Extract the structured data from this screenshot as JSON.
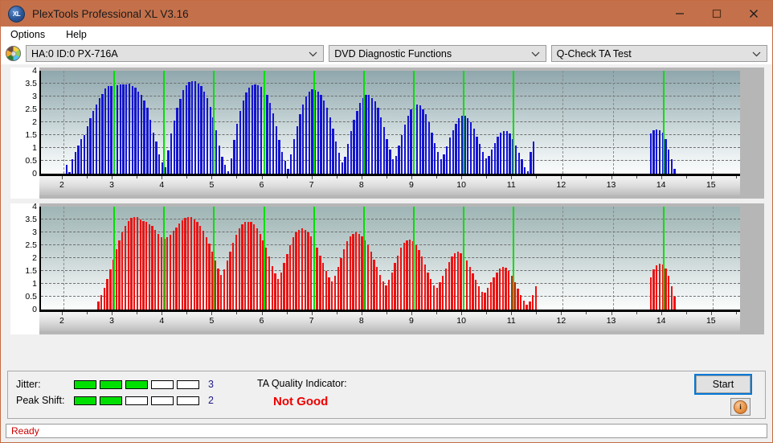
{
  "window": {
    "title": "PlexTools Professional XL V3.16",
    "app_icon": "xl-disc-icon",
    "controls": {
      "minimize": "minimize-icon",
      "maximize": "maximize-icon",
      "close": "close-icon"
    }
  },
  "menubar": {
    "items": [
      {
        "label": "Options"
      },
      {
        "label": "Help"
      }
    ]
  },
  "toolbar": {
    "drive_icon": "disc-icon",
    "drive": "HA:0 ID:0  PX-716A",
    "function": "DVD Diagnostic Functions",
    "test": "Q-Check TA Test"
  },
  "bottom": {
    "jitter_label": "Jitter:",
    "jitter_value": "3",
    "jitter_filled": 3,
    "jitter_total": 5,
    "peak_shift_label": "Peak Shift:",
    "peak_shift_value": "2",
    "peak_shift_filled": 2,
    "peak_shift_total": 5,
    "ta_label": "TA Quality Indicator:",
    "ta_value": "Not Good",
    "ta_color": "#ee0000",
    "start_label": "Start",
    "info_label": "i"
  },
  "statusbar": {
    "text": "Ready"
  },
  "chart_data": [
    {
      "id": "ta-jitter-chart",
      "type": "bar",
      "title": "",
      "xlabel": "",
      "ylabel": "",
      "xlim": [
        1.55,
        15.55
      ],
      "ylim": [
        0,
        4
      ],
      "yticks": [
        0,
        0.5,
        1,
        1.5,
        2,
        2.5,
        3,
        3.5,
        4
      ],
      "xticks": [
        2,
        3,
        4,
        5,
        6,
        7,
        8,
        9,
        10,
        11,
        12,
        13,
        14,
        15
      ],
      "grid": true,
      "bar_color": "#1414d2",
      "marker_color": "#00e000",
      "markers": [
        3,
        4,
        5,
        6,
        7,
        8,
        9,
        10,
        11,
        14
      ],
      "x": [
        2.06,
        2.12,
        2.18,
        2.24,
        2.3,
        2.36,
        2.42,
        2.48,
        2.54,
        2.6,
        2.66,
        2.72,
        2.78,
        2.84,
        2.9,
        2.96,
        3.02,
        3.08,
        3.14,
        3.2,
        3.26,
        3.32,
        3.38,
        3.44,
        3.5,
        3.56,
        3.62,
        3.68,
        3.74,
        3.8,
        3.86,
        3.92,
        3.98,
        4.04,
        4.1,
        4.16,
        4.22,
        4.28,
        4.34,
        4.4,
        4.46,
        4.52,
        4.58,
        4.64,
        4.7,
        4.76,
        4.82,
        4.88,
        4.94,
        5.0,
        5.06,
        5.12,
        5.18,
        5.24,
        5.3,
        5.36,
        5.42,
        5.48,
        5.54,
        5.6,
        5.66,
        5.72,
        5.78,
        5.84,
        5.9,
        5.96,
        6.02,
        6.08,
        6.14,
        6.2,
        6.26,
        6.32,
        6.38,
        6.44,
        6.5,
        6.56,
        6.62,
        6.68,
        6.74,
        6.8,
        6.86,
        6.92,
        6.98,
        7.04,
        7.1,
        7.16,
        7.22,
        7.28,
        7.34,
        7.4,
        7.46,
        7.52,
        7.58,
        7.64,
        7.7,
        7.76,
        7.82,
        7.88,
        7.94,
        8.0,
        8.06,
        8.12,
        8.18,
        8.24,
        8.3,
        8.36,
        8.42,
        8.48,
        8.54,
        8.6,
        8.66,
        8.72,
        8.78,
        8.84,
        8.9,
        8.96,
        9.02,
        9.08,
        9.14,
        9.2,
        9.26,
        9.32,
        9.38,
        9.44,
        9.5,
        9.56,
        9.62,
        9.68,
        9.74,
        9.8,
        9.86,
        9.92,
        9.98,
        10.04,
        10.1,
        10.16,
        10.22,
        10.28,
        10.34,
        10.4,
        10.46,
        10.52,
        10.58,
        10.64,
        10.7,
        10.76,
        10.82,
        10.88,
        10.94,
        11.0,
        11.06,
        11.12,
        11.18,
        11.24,
        11.3,
        11.36,
        11.42,
        13.76,
        13.82,
        13.88,
        13.94,
        14.0,
        14.06,
        14.12,
        14.18,
        14.24,
        14.3
      ],
      "values": [
        0.35,
        0.05,
        0.55,
        0.85,
        1.1,
        1.35,
        1.5,
        1.85,
        2.15,
        2.45,
        2.7,
        2.95,
        3.1,
        3.3,
        3.4,
        3.42,
        3.45,
        3.45,
        3.48,
        3.48,
        3.48,
        3.5,
        3.42,
        3.35,
        3.2,
        3.05,
        2.85,
        2.55,
        2.1,
        1.6,
        1.25,
        0.75,
        0.45,
        0.25,
        0.9,
        1.55,
        2.05,
        2.55,
        2.9,
        3.25,
        3.45,
        3.55,
        3.6,
        3.58,
        3.5,
        3.4,
        3.2,
        2.95,
        2.6,
        2.2,
        1.7,
        1.1,
        0.65,
        0.35,
        0.1,
        0.6,
        1.3,
        1.95,
        2.45,
        2.85,
        3.15,
        3.35,
        3.45,
        3.48,
        3.45,
        3.38,
        3.25,
        3.05,
        2.75,
        2.35,
        1.85,
        1.3,
        0.85,
        0.5,
        0.2,
        0.75,
        1.35,
        1.85,
        2.3,
        2.7,
        3.0,
        3.2,
        3.28,
        3.25,
        3.2,
        3.05,
        2.85,
        2.55,
        2.2,
        1.75,
        1.25,
        0.8,
        0.45,
        0.65,
        1.15,
        1.65,
        2.1,
        2.45,
        2.75,
        2.95,
        3.05,
        3.05,
        2.95,
        2.8,
        2.55,
        2.2,
        1.8,
        1.35,
        0.95,
        0.55,
        0.7,
        1.1,
        1.5,
        1.9,
        2.25,
        2.5,
        2.65,
        2.7,
        2.65,
        2.5,
        2.3,
        2.0,
        1.6,
        1.2,
        0.85,
        0.55,
        0.75,
        1.05,
        1.4,
        1.7,
        1.95,
        2.15,
        2.25,
        2.25,
        2.15,
        2.0,
        1.75,
        1.45,
        1.15,
        0.85,
        0.6,
        0.7,
        0.95,
        1.2,
        1.45,
        1.6,
        1.65,
        1.65,
        1.55,
        1.35,
        1.1,
        0.8,
        0.55,
        0.25,
        0.1,
        0.85,
        1.25,
        1.55,
        1.7,
        1.72,
        1.7,
        1.6,
        1.35,
        0.95,
        0.55,
        0.2
      ]
    },
    {
      "id": "ta-peakshift-chart",
      "type": "bar",
      "title": "",
      "xlabel": "",
      "ylabel": "",
      "xlim": [
        1.55,
        15.55
      ],
      "ylim": [
        0,
        4
      ],
      "yticks": [
        0,
        0.5,
        1,
        1.5,
        2,
        2.5,
        3,
        3.5,
        4
      ],
      "xticks": [
        2,
        3,
        4,
        5,
        6,
        7,
        8,
        9,
        10,
        11,
        12,
        13,
        14,
        15
      ],
      "grid": true,
      "bar_color": "#ee1111",
      "marker_color": "#00e000",
      "markers": [
        3,
        4,
        5,
        6,
        7,
        8,
        9,
        10,
        11,
        14
      ],
      "x": [
        2.7,
        2.76,
        2.82,
        2.88,
        2.94,
        3.0,
        3.06,
        3.12,
        3.18,
        3.24,
        3.3,
        3.36,
        3.42,
        3.48,
        3.54,
        3.6,
        3.66,
        3.72,
        3.78,
        3.84,
        3.9,
        3.96,
        4.02,
        4.08,
        4.14,
        4.2,
        4.26,
        4.32,
        4.38,
        4.44,
        4.5,
        4.56,
        4.62,
        4.68,
        4.74,
        4.8,
        4.86,
        4.92,
        4.98,
        5.04,
        5.1,
        5.16,
        5.22,
        5.28,
        5.34,
        5.4,
        5.46,
        5.52,
        5.58,
        5.64,
        5.7,
        5.76,
        5.82,
        5.88,
        5.94,
        6.0,
        6.06,
        6.12,
        6.18,
        6.24,
        6.3,
        6.36,
        6.42,
        6.48,
        6.54,
        6.6,
        6.66,
        6.72,
        6.78,
        6.84,
        6.9,
        6.96,
        7.02,
        7.08,
        7.14,
        7.2,
        7.26,
        7.32,
        7.38,
        7.44,
        7.5,
        7.56,
        7.62,
        7.68,
        7.74,
        7.8,
        7.86,
        7.92,
        7.98,
        8.04,
        8.1,
        8.16,
        8.22,
        8.28,
        8.34,
        8.4,
        8.46,
        8.52,
        8.58,
        8.64,
        8.7,
        8.76,
        8.82,
        8.88,
        8.94,
        9.0,
        9.06,
        9.12,
        9.18,
        9.24,
        9.3,
        9.36,
        9.42,
        9.48,
        9.54,
        9.6,
        9.66,
        9.72,
        9.78,
        9.84,
        9.9,
        9.96,
        10.02,
        10.08,
        10.14,
        10.2,
        10.26,
        10.32,
        10.38,
        10.44,
        10.5,
        10.56,
        10.62,
        10.68,
        10.74,
        10.8,
        10.86,
        10.92,
        10.98,
        11.04,
        11.1,
        11.16,
        11.22,
        11.28,
        11.34,
        11.4,
        11.46,
        13.76,
        13.82,
        13.88,
        13.94,
        14.0,
        14.06,
        14.12,
        14.18,
        14.24,
        14.3
      ],
      "values": [
        0.3,
        0.55,
        0.85,
        1.2,
        1.55,
        1.95,
        2.35,
        2.7,
        3.0,
        3.25,
        3.45,
        3.55,
        3.6,
        3.58,
        3.5,
        3.45,
        3.4,
        3.3,
        3.25,
        3.1,
        2.95,
        2.8,
        2.75,
        2.8,
        2.9,
        3.05,
        3.2,
        3.35,
        3.48,
        3.55,
        3.6,
        3.58,
        3.5,
        3.4,
        3.25,
        3.05,
        2.8,
        2.55,
        2.25,
        1.9,
        1.6,
        1.35,
        1.55,
        1.9,
        2.25,
        2.6,
        2.9,
        3.15,
        3.3,
        3.4,
        3.42,
        3.4,
        3.3,
        3.15,
        2.95,
        2.7,
        2.4,
        2.05,
        1.7,
        1.4,
        1.2,
        1.45,
        1.8,
        2.15,
        2.5,
        2.8,
        3.0,
        3.1,
        3.15,
        3.1,
        3.0,
        2.85,
        2.65,
        2.4,
        2.1,
        1.8,
        1.5,
        1.25,
        1.1,
        1.3,
        1.65,
        2.0,
        2.35,
        2.65,
        2.85,
        2.95,
        3.0,
        2.95,
        2.85,
        2.7,
        2.5,
        2.25,
        1.95,
        1.65,
        1.35,
        1.1,
        0.95,
        1.15,
        1.45,
        1.8,
        2.1,
        2.4,
        2.6,
        2.7,
        2.72,
        2.65,
        2.5,
        2.3,
        2.05,
        1.75,
        1.45,
        1.2,
        0.95,
        0.85,
        1.05,
        1.3,
        1.6,
        1.85,
        2.05,
        2.2,
        2.25,
        2.2,
        2.1,
        1.9,
        1.65,
        1.4,
        1.15,
        0.9,
        0.7,
        0.65,
        0.85,
        1.05,
        1.25,
        1.45,
        1.6,
        1.65,
        1.62,
        1.5,
        1.3,
        1.05,
        0.8,
        0.55,
        0.35,
        0.2,
        0.3,
        0.55,
        0.9,
        1.25,
        1.55,
        1.72,
        1.78,
        1.75,
        1.6,
        1.3,
        0.9,
        0.5
      ]
    }
  ]
}
